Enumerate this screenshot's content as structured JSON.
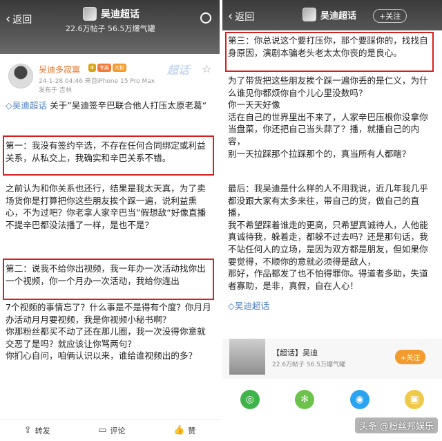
{
  "left": {
    "header": {
      "back_label": "返回",
      "title": "吴迪超话",
      "stats": "22.6万帖子 56.5万爆气罐"
    },
    "post": {
      "username": "吴迪多寂寞",
      "badges": [
        "Ⅲ",
        "专属",
        "大粉"
      ],
      "supertag": "超话",
      "meta": "24-1-28 04:46  来自iPhone 15 Pro Max",
      "location": "发布于 吉林",
      "intro_link": "吴迪超话",
      "intro_text": " 关于”吴迪签辛巴联合他人打压太原老葛“",
      "para1": "第一：我没有签约辛选，不存在任何合同绑定或利益关系，从私交上，我确实和辛巴关系不错。",
      "para2": "之前认为和你关系也还行，结果是我太天真，为了卖场货你是打算把你这些朋友挨个踩一遍，说利益熏心，不为过吧？你老拿人家辛巴当”假想敌“好像直播不提辛巴都没法播了一样，是也不是？",
      "para3": "第二：说我不给你出视频，我一年办一次活动找你出一个视频，你一个月办一次活动，我给你连出",
      "para4": "7个视频的事情忘了？什么事是不是得有个度？你月月办活动月月要视频，我是你视频小秘书啊？\n你那粉丝都买不动了还在那儿圈，我一次没得你意就交恶了是吗？就应该让你骂两句？\n你扪心自问，咱俩认识以来，谁给谁视频出的多？"
    },
    "actions": {
      "repost": "转发",
      "comment": "评论",
      "like": "赞"
    }
  },
  "right": {
    "header": {
      "back_label": "返回",
      "title": "吴迪超话",
      "follow": "+关注"
    },
    "para1": "第三：你总说这个要打压你，那个要踩你的，找找自身原因，演剧本骗老头老太太你丧的是良心。",
    "para2": "为了带货把这些朋友挨个踩一遍你丢的是仁义，为什么谁见你都烦你自个儿心里没数吗？\n你一天天好像\n活在自己的世界里出不来了，人家辛巴压根你没拿你当盘菜，你还把自己当头蒜了？播，就播自己的内容，\n别一天拉踩那个拉踩那个的，真当所有人都瞎？",
    "para3": "最后：我吴迪是什么样的人不用我说，近几年我几乎都没跟大家有太多来往，带自己的货，做自己的直播，\n我不希望踩着谁走的更高，只希望真诚待人，人他能真诚待我，躲着走，都躲不过去吗？还是那句话，我不站任何人的立场，是因为双方都是朋友，但如果你要觉得，不顺你的意就必须得是敌人，\n那好，作品都发了也不怕得罪你。得道者多助，失道者寡助，是非，真假，自在人心！",
    "end_link": "吴迪超话",
    "topic_card": {
      "title": "【超话】吴迪",
      "stats": "22.6万帖子 56.5万爆气罐",
      "follow": "+关注"
    },
    "watermark": "头条 @粉丝邦娱乐"
  }
}
